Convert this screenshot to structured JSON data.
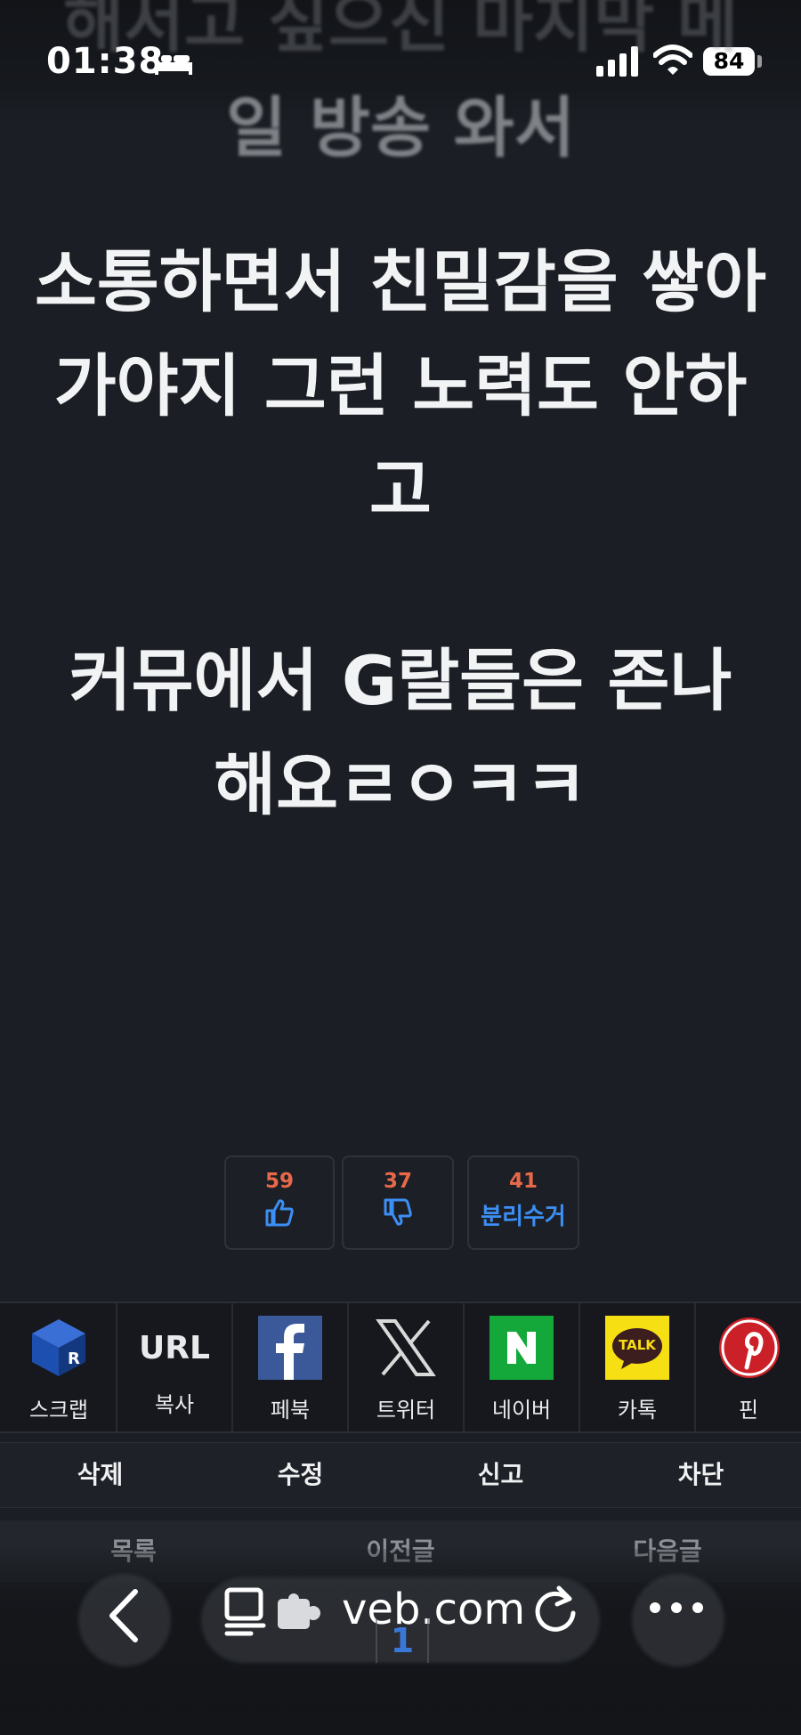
{
  "status_bar": {
    "time": "01:38",
    "battery": "84"
  },
  "post": {
    "faded_heading_top": "해서고 싶으신 마지막 메",
    "faded_heading": "일 방송 와서",
    "paragraph_1": "소통하면서 친밀감을 쌓아가야지 그런 노력도 안하고",
    "paragraph_2": "커뮤에서 G랄들은 존나 해요ㄹㅇㅋㅋ"
  },
  "votes": {
    "like_count": "59",
    "dislike_count": "37",
    "separate_count": "41",
    "separate_label": "분리수거"
  },
  "share": {
    "scrap_label": "스크랩",
    "url_title": "URL",
    "url_label": "복사",
    "facebook_label": "페북",
    "twitter_label": "트위터",
    "naver_label": "네이버",
    "kakao_label": "카톡",
    "kakao_logo_text": "TALK",
    "pinterest_label": "핀"
  },
  "actions": {
    "delete": "삭제",
    "edit": "수정",
    "report": "신고",
    "block": "차단"
  },
  "navigation": {
    "list": "목록",
    "prev": "이전글",
    "next": "다음글",
    "page": "1"
  },
  "browser": {
    "url": "veb.com"
  },
  "colors": {
    "background": "#1b1e24",
    "vote_count": "#e8684a",
    "accent_blue": "#3b8ff5",
    "naver_green": "#14a83b",
    "kakao_yellow": "#f6df13",
    "facebook_blue": "#3b5998",
    "pinterest_red": "#cb2027"
  }
}
